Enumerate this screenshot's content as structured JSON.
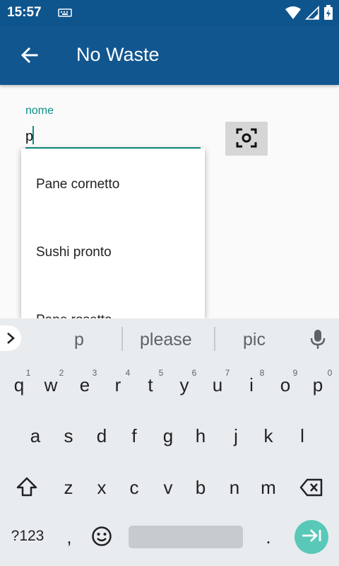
{
  "status_bar": {
    "time": "15:57",
    "icons": [
      "keyboard-icon",
      "wifi-icon",
      "signal-icon",
      "battery-charging-icon"
    ]
  },
  "app_bar": {
    "title": "No Waste",
    "back_icon": "arrow-back-icon"
  },
  "form": {
    "name_label": "nome",
    "name_value": "p",
    "scan_icon": "barcode-scan-icon"
  },
  "autocomplete": {
    "items": [
      "Pane cornetto",
      "Sushi pronto",
      "Pane rosetta"
    ]
  },
  "keyboard": {
    "suggestions": [
      "p",
      "please",
      "pic"
    ],
    "row1": [
      "q",
      "w",
      "e",
      "r",
      "t",
      "y",
      "u",
      "i",
      "o",
      "p"
    ],
    "row1_hints": [
      "1",
      "2",
      "3",
      "4",
      "5",
      "6",
      "7",
      "8",
      "9",
      "0"
    ],
    "row2": [
      "a",
      "s",
      "d",
      "f",
      "g",
      "h",
      "j",
      "k",
      "l"
    ],
    "row3": [
      "z",
      "x",
      "c",
      "v",
      "b",
      "n",
      "m"
    ],
    "symbols_label": "?123",
    "comma": ",",
    "period": ".",
    "accent_color": "#5ac8b8",
    "bar_color": "#11568f"
  }
}
